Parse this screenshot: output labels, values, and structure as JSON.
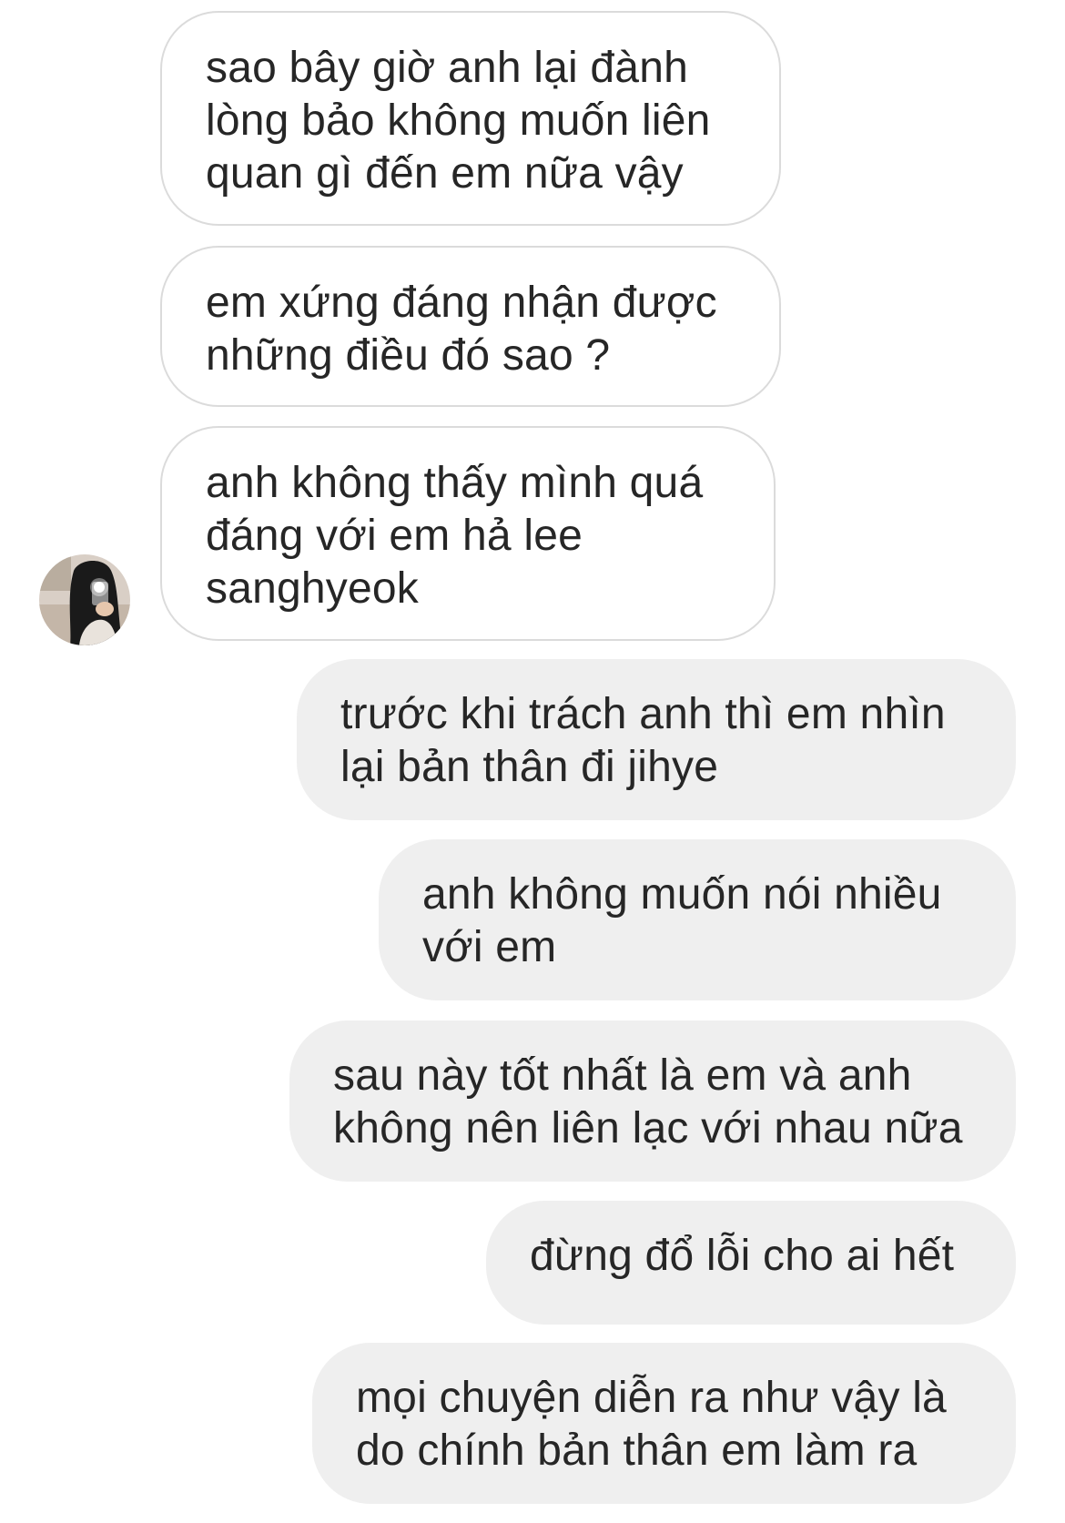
{
  "conversation": {
    "received": [
      {
        "text": "sao bây giờ anh lại đành\nlòng bảo không muốn liên\nquan gì đến em nữa vậy"
      },
      {
        "text": "em xứng đáng nhận được\nnhững điều đó sao ?"
      },
      {
        "text": "anh không thấy mình quá\nđáng với em hả lee\nsanghyeok"
      }
    ],
    "sent": [
      {
        "text": "trước khi trách anh thì em nhìn\nlại bản thân đi jihye"
      },
      {
        "text": "anh không muốn nói nhiều\nvới em"
      },
      {
        "text": "sau này tốt nhất là em và anh\nkhông nên liên lạc với nhau nữa"
      },
      {
        "text": "đừng đổ lỗi cho ai hết"
      },
      {
        "text": "mọi chuyện diễn ra như vậy là\ndo chính bản thân em làm ra"
      }
    ],
    "avatar": {
      "icon": "contact-avatar-photo"
    }
  },
  "colors": {
    "received_bubble_bg": "#ffffff",
    "received_bubble_border": "#dbdbdb",
    "sent_bubble_bg": "#efefef",
    "text": "#262626"
  }
}
